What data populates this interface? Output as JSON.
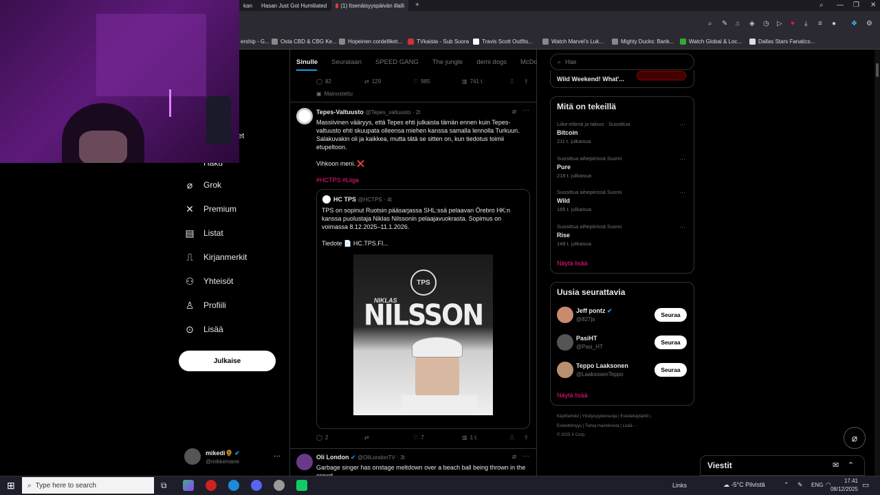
{
  "browser": {
    "tabs": [
      {
        "label": "Hasan Just Got Humiliated"
      },
      {
        "label": "(1) Itsenäisyyspäivän illalli"
      }
    ],
    "bookmarks": [
      "ership - G...",
      "Osta CBD & CBG Ke...",
      "Hopeinen cordelliket...",
      "TVkaista - Sub Suora",
      "Travis Scott Outfits...",
      "Watch Marvel's Luk...",
      "Mighty Ducks: Bank...",
      "Watch Global & Loc...",
      "Dallas Stars Fanatics..."
    ]
  },
  "nav": {
    "partial_label": "Haku",
    "partial_label2": "et",
    "items": [
      {
        "label": "Grok",
        "icon": "grok-icon",
        "glyph": "⌀"
      },
      {
        "label": "Premium",
        "icon": "x-logo-icon",
        "glyph": "✕"
      },
      {
        "label": "Listat",
        "icon": "list-icon",
        "glyph": "▤"
      },
      {
        "label": "Kirjanmerkit",
        "icon": "bookmark-icon",
        "glyph": "🔖"
      },
      {
        "label": "Yhteisöt",
        "icon": "communities-icon",
        "glyph": "👥"
      },
      {
        "label": "Profiili",
        "icon": "profile-icon",
        "glyph": "👤"
      },
      {
        "label": "Lisää",
        "icon": "more-circle-icon",
        "glyph": "⋯"
      }
    ],
    "post_label": "Julkaise",
    "account": {
      "name": "mikedi",
      "emoji": "🌻",
      "handle": "@mikkemane"
    }
  },
  "timeline": {
    "tabs": [
      "Sinulle",
      "Seurataan",
      "SPEED GANG",
      "The jungle",
      "demi dogs",
      "McDonal"
    ],
    "ad_stats": {
      "replies": "82",
      "reposts": "129",
      "likes": "985",
      "views": "741 t."
    },
    "promoted_label": "Mainostettu",
    "tweet1": {
      "name": "Tepes-Valtuusto",
      "handle": "@Tepes_valtuusto",
      "time": "· 2t",
      "text": "Massiivinen vääryys, että Tepes ehti julkaista tämän ennen kuin Tepes-valtuusto ehti skuupata olleensa miehen kanssa samalla lennolla Turkuun. Salakuvakin oli ja kaikkea, mutta tätä se sitten on, kun tiedotus toimii etupeltoon.",
      "text2": "Vihkoon meni. ❌",
      "hashtags": "#HCTPS #Liiga",
      "quote": {
        "name": "HC TPS",
        "handle": "@HCTPS",
        "time": "· 4t",
        "text": "TPS on sopinut Ruotsin pääsarjassa SHL:ssä pelaavan Örebro HK:n kanssa puolustaja Niklas Nilssonin pelaajavuokrasta. Sopimus on voimassa 8.12.2025–11.1.2026.",
        "link": "Tiedote 📄 HC.TPS.FI...",
        "image_title_top": "NIKLAS",
        "image_title": "NILSSON",
        "image_logo": "TPS"
      },
      "stats": {
        "replies": "2",
        "reposts": "",
        "likes": "7",
        "views": "1 t."
      }
    },
    "tweet2": {
      "name": "Oli London",
      "handle": "@OliLondonTV",
      "time": "· 3t",
      "text": "Garbage singer has onstage meltdown over a beach ball being thrown in the crowd"
    }
  },
  "right": {
    "search_placeholder": "Hae",
    "top_card_text": "Wild Weekend! What'...",
    "trends_title": "Mitä on tekeillä",
    "trends": [
      {
        "category": "Liike-elämä ja talous · Suosittua",
        "name": "Bitcoin",
        "count": "211 t. julkaisua"
      },
      {
        "category": "Suosittua aihepiirissä Suomi",
        "name": "Pure",
        "count": "218 t. julkaisua"
      },
      {
        "category": "Suosittua aihepiirissä Suomi",
        "name": "Wild",
        "count": "185 t. julkaisua"
      },
      {
        "category": "Suosittua aihepiirissä Suomi",
        "name": "Rise",
        "count": "148 t. julkaisua"
      }
    ],
    "show_more": "Näytä lisää",
    "follow_title": "Uusia seurattavia",
    "follow": [
      {
        "name": "Jeff pontz",
        "handle": "@827js",
        "verified": true,
        "btn": "Seuraa"
      },
      {
        "name": "PasiHT",
        "handle": "@Pasi_HT",
        "verified": false,
        "btn": "Seuraa"
      },
      {
        "name": "Teppo Laaksonen",
        "handle": "@LaaksosenTeppo",
        "verified": false,
        "btn": "Seuraa"
      }
    ],
    "footer_line1": "Käyttöehdot | Yksityisyydensuoja | Evästekäytäntö |",
    "footer_line2": "Esteettömyys | Tietoa mainoksista | Lisää ···",
    "footer_line3": "© 2025 X Corp.",
    "messages": "Viestit"
  },
  "taskbar": {
    "search_placeholder": "Type here to search",
    "links": "Links",
    "weather": "-5°C  Pilvistä",
    "lang": "ENG",
    "time": "17.41",
    "date": "08/12/2025"
  },
  "colors": {
    "accent": "#f91880",
    "verified": "#1d9bf0",
    "bg": "#000000"
  }
}
